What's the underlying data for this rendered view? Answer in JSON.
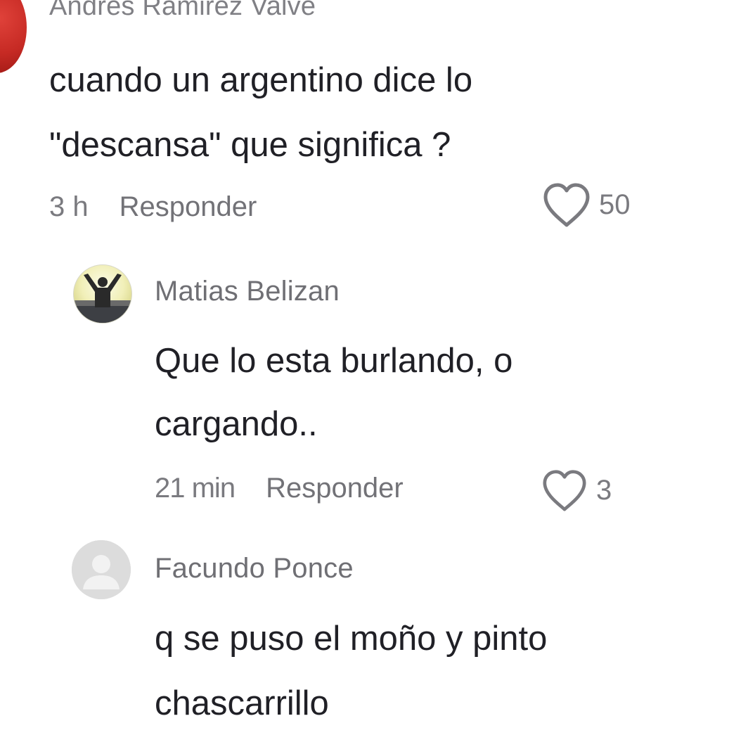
{
  "comments": [
    {
      "author": "Andres Ramirez Valve",
      "text_lines": [
        "cuando un argentino dice lo",
        "\"descansa\" que significa ?"
      ],
      "time": "3 h",
      "reply_label": "Responder",
      "likes": "50"
    },
    {
      "author": "Matias Belizan",
      "text_lines": [
        "Que lo esta burlando, o",
        "cargando.."
      ],
      "time": "21 min",
      "reply_label": "Responder",
      "likes": "3"
    },
    {
      "author": "Facundo Ponce",
      "text_lines": [
        "q se puso el moño y pinto",
        "chascarrillo"
      ]
    }
  ],
  "icons": {
    "like": "heart-outline-icon",
    "avatar_placeholder": "user-placeholder-icon"
  },
  "colors": {
    "text": "#202026",
    "secondary": "#7a7a7f",
    "avatar1": "#c62a24"
  }
}
